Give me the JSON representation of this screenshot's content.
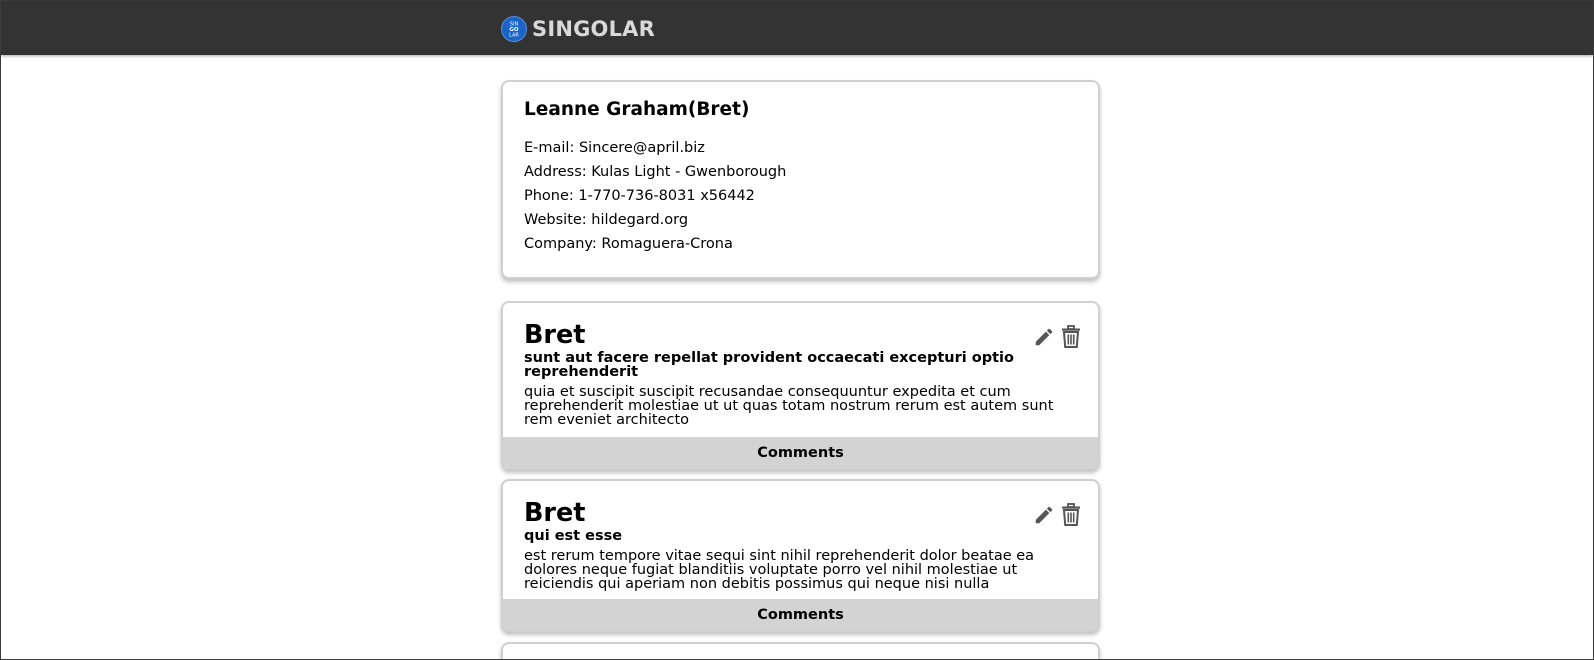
{
  "navbar": {
    "brand": "SINGOLAR",
    "logo_text": "SIN GO LAR",
    "logo_color": "#1a64c8",
    "background": "#333333"
  },
  "profile": {
    "name": "Leanne Graham(Bret)",
    "email_line": "E-mail: Sincere@april.biz",
    "address_line": "Address: Kulas Light - Gwenborough",
    "phone_line": "Phone: 1-770-736-8031 x56442",
    "website_line": "Website: hildegard.org",
    "company_line": "Company: Romaguera-Crona"
  },
  "posts": [
    {
      "author": "Bret",
      "title": "sunt aut facere repellat provident occaecati excepturi optio reprehenderit",
      "body": "quia et suscipit suscipit recusandae consequuntur expedita et cum reprehenderit molestiae ut ut quas totam nostrum rerum est autem sunt rem eveniet architecto",
      "comments_label": "Comments",
      "edit_icon": "pencil-icon",
      "delete_icon": "trash-icon"
    },
    {
      "author": "Bret",
      "title": "qui est esse",
      "body": "est rerum tempore vitae sequi sint nihil reprehenderit dolor beatae ea dolores neque fugiat blanditiis voluptate porro vel nihil molestiae ut reiciendis qui aperiam non debitis possimus qui neque nisi nulla",
      "comments_label": "Comments",
      "edit_icon": "pencil-icon",
      "delete_icon": "trash-icon"
    }
  ]
}
